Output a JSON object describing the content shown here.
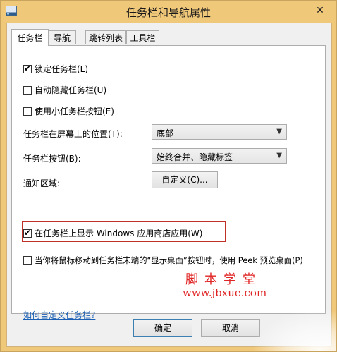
{
  "window": {
    "title": "任务栏和导航属性",
    "close_glyph": "✕"
  },
  "tabs": [
    {
      "label": "任务栏",
      "active": true
    },
    {
      "label": "导航"
    },
    {
      "label": "跳转列表"
    },
    {
      "label": "工具栏"
    }
  ],
  "options": {
    "lock_taskbar": {
      "label": "锁定任务栏(L)",
      "checked": true
    },
    "autohide": {
      "label": "自动隐藏任务栏(U)",
      "checked": false
    },
    "small_buttons": {
      "label": "使用小任务栏按钮(E)",
      "checked": false
    },
    "show_store_apps": {
      "label": "在任务栏上显示 Windows 应用商店应用(W)",
      "checked": true
    },
    "peek": {
      "label": "当你将鼠标移动到任务栏末端的“显示桌面”按钮时，使用 Peek 预览桌面(P)",
      "checked": false
    }
  },
  "position": {
    "label": "任务栏在屏幕上的位置(T):",
    "value": "底部"
  },
  "buttons_setting": {
    "label": "任务栏按钮(B):",
    "value": "始终合并、隐藏标签"
  },
  "notification": {
    "label": "通知区域:",
    "button": "自定义(C)..."
  },
  "help_link": "如何自定义任务栏?",
  "watermark": {
    "cn": "脚本学堂",
    "url": "www.jbxue.com"
  },
  "footer": {
    "ok": "确定",
    "cancel": "取消"
  },
  "colors": {
    "frame": "#f0c87a",
    "highlight": "#c0302a",
    "link": "#1a5fb4",
    "watermark": "#e02424"
  }
}
